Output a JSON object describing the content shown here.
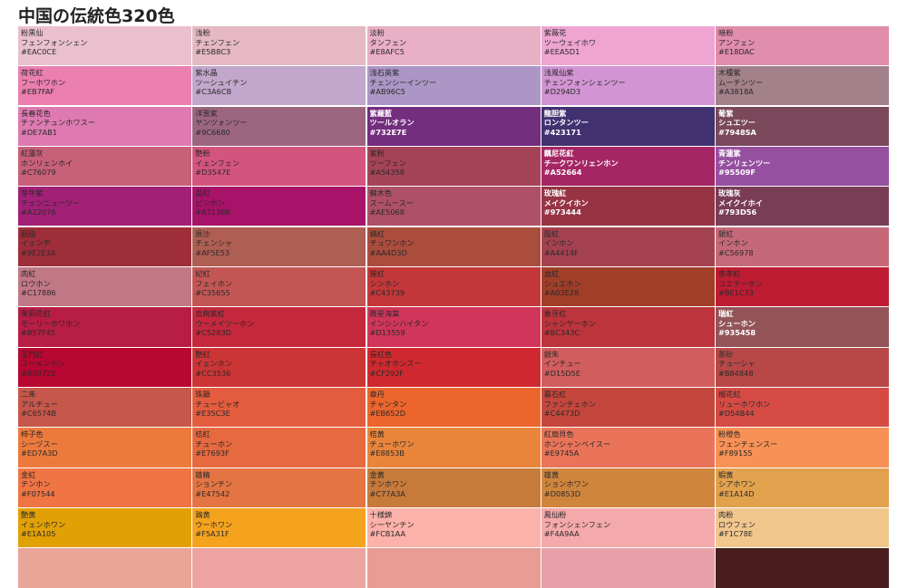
{
  "page": {
    "title": "中国の伝統色320色"
  },
  "colors": [
    {
      "name": "粉黒仙",
      "reading": "フェンフォンシェン",
      "hex": "#EAC0CE",
      "tone": "light"
    },
    {
      "name": "浅粉",
      "reading": "チェンフェン",
      "hex": "#E5B8C3",
      "tone": "light"
    },
    {
      "name": "淡粉",
      "reading": "タンフェン",
      "hex": "#E8AFC5",
      "tone": "light"
    },
    {
      "name": "紫薇花",
      "reading": "ツーウェイホワ",
      "hex": "#EEA5D1",
      "tone": "light"
    },
    {
      "name": "暗粉",
      "reading": "アンフェン",
      "hex": "#E18DAC",
      "tone": "light"
    },
    {
      "name": "荷花紅",
      "reading": "フーホワホン",
      "hex": "#EB7FAF",
      "tone": "light"
    },
    {
      "name": "紫水晶",
      "reading": "ツーシュイチン",
      "hex": "#C3A6CB",
      "tone": "light"
    },
    {
      "name": "浅石英紫",
      "reading": "チェンシーインツー",
      "hex": "#AB96C5",
      "tone": "light"
    },
    {
      "name": "浅風仙紫",
      "reading": "チェンフォンシェンツー",
      "hex": "#D294D3",
      "tone": "light"
    },
    {
      "name": "木槿紫",
      "reading": "ムーチンツー",
      "hex": "#A3818A",
      "tone": "light"
    },
    {
      "name": "長春花色",
      "reading": "チァンチュンホワスー",
      "hex": "#DE7AB1",
      "tone": "light"
    },
    {
      "name": "洋葱紫",
      "reading": "ヤンツォンツー",
      "hex": "#9C6680",
      "tone": "light"
    },
    {
      "name": "紫羅藍",
      "reading": "ツールオラン",
      "hex": "#732E7E",
      "tone": "dark"
    },
    {
      "name": "龍胆紫",
      "reading": "ロンタンツー",
      "hex": "#423171",
      "tone": "dark"
    },
    {
      "name": "葡紫",
      "reading": "シュエツー",
      "hex": "#7948SA",
      "tone": "dark"
    },
    {
      "name": "紅蓮灰",
      "reading": "ホンリェンホイ",
      "hex": "#C76079",
      "tone": "light"
    },
    {
      "name": "艶粉",
      "reading": "イェンフェン",
      "hex": "#D3547E",
      "tone": "light"
    },
    {
      "name": "紫粉",
      "reading": "ツーフェン",
      "hex": "#A54358",
      "tone": "light"
    },
    {
      "name": "藕尼花紅",
      "reading": "チークワンリェンホン",
      "hex": "#A52664",
      "tone": "dark"
    },
    {
      "name": "青蓮紫",
      "reading": "チンリェンツー",
      "hex": "#95509F",
      "tone": "dark"
    },
    {
      "name": "芽牛紫",
      "reading": "チェンニューツー",
      "hex": "#A22076",
      "tone": "light"
    },
    {
      "name": "品紅",
      "reading": "ピンホン",
      "hex": "#A71368",
      "tone": "light"
    },
    {
      "name": "蘇木色",
      "reading": "スームースー",
      "hex": "#AE5068",
      "tone": "light"
    },
    {
      "name": "玫瑰紅",
      "reading": "メイクイホン",
      "hex": "#973444",
      "tone": "dark"
    },
    {
      "name": "玫瑰灰",
      "reading": "メイクイホイ",
      "hex": "#793D56",
      "tone": "dark"
    },
    {
      "name": "胭脂",
      "reading": "イェンヂ",
      "hex": "#9E2E3A",
      "tone": "light"
    },
    {
      "name": "辰沙",
      "reading": "チェンシャ",
      "hex": "#AF5E53",
      "tone": "light"
    },
    {
      "name": "鶏紅",
      "reading": "チュワンホン",
      "hex": "#AA4D3D",
      "tone": "light"
    },
    {
      "name": "殷紅",
      "reading": "インホン",
      "hex": "#A4414F",
      "tone": "light"
    },
    {
      "name": "銀紅",
      "reading": "インホン",
      "hex": "#C56978",
      "tone": "light"
    },
    {
      "name": "肉紅",
      "reading": "ロウホン",
      "hex": "#C17886",
      "tone": "light"
    },
    {
      "name": "妃紅",
      "reading": "フェイホン",
      "hex": "#C35655",
      "tone": "light"
    },
    {
      "name": "猩紅",
      "reading": "シンホン",
      "hex": "#C43739",
      "tone": "light"
    },
    {
      "name": "血紅",
      "reading": "シュエホン",
      "hex": "#A03E28",
      "tone": "light"
    },
    {
      "name": "赤孝紅",
      "reading": "ユエテーホン",
      "hex": "#BE1C33",
      "tone": "light"
    },
    {
      "name": "茉莉花紅",
      "reading": "モーリーホワホン",
      "hex": "#B57F45",
      "tone": "light"
    },
    {
      "name": "烏梅紫紅",
      "reading": "ウーメイツーホン",
      "hex": "#C5283D",
      "tone": "light"
    },
    {
      "name": "霞星海棠",
      "reading": "インシンハイタン",
      "hex": "#D13559",
      "tone": "light"
    },
    {
      "name": "象牙紅",
      "reading": "シャンヤーホン",
      "hex": "#BC343C",
      "tone": "light"
    },
    {
      "name": "瑞紅",
      "reading": "シューホン",
      "hex": "#935458",
      "tone": "dark"
    },
    {
      "name": "玉門紅",
      "reading": "ユーメンホン",
      "hex": "#B80722",
      "tone": "light"
    },
    {
      "name": "艶紅",
      "reading": "イェンホン",
      "hex": "#CC3536",
      "tone": "light"
    },
    {
      "name": "長紅色",
      "reading": "チャオホンスー",
      "hex": "#CF292F",
      "tone": "light"
    },
    {
      "name": "銀朱",
      "reading": "インチュー",
      "hex": "#D15D5E",
      "tone": "light"
    },
    {
      "name": "茶砂",
      "reading": "チューシャ",
      "hex": "#B84848",
      "tone": "light"
    },
    {
      "name": "二朱",
      "reading": "アルチュー",
      "hex": "#C6574B",
      "tone": "light"
    },
    {
      "name": "珠顕",
      "reading": "チュービャオ",
      "hex": "#E35C3E",
      "tone": "light"
    },
    {
      "name": "章丹",
      "reading": "チャンタン",
      "hex": "#EB652D",
      "tone": "light"
    },
    {
      "name": "暮石紅",
      "reading": "ファンチェホン",
      "hex": "#C4473D",
      "tone": "light"
    },
    {
      "name": "榴花紅",
      "reading": "リューホワホン",
      "hex": "#D54B44",
      "tone": "light"
    },
    {
      "name": "柿子色",
      "reading": "シーヅスー",
      "hex": "#ED7A3D",
      "tone": "light"
    },
    {
      "name": "桔紅",
      "reading": "チューホン",
      "hex": "#E7693F",
      "tone": "light"
    },
    {
      "name": "桔黄",
      "reading": "チューホワン",
      "hex": "#E8853B",
      "tone": "light"
    },
    {
      "name": "紅扇貝色",
      "reading": "ホンシャンベイスー",
      "hex": "#E9745A",
      "tone": "light"
    },
    {
      "name": "粉橙色",
      "reading": "フェンチェンスー",
      "hex": "#F89155",
      "tone": "light"
    },
    {
      "name": "金紅",
      "reading": "チンホン",
      "hex": "#F07544",
      "tone": "light"
    },
    {
      "name": "雄精",
      "reading": "ションチン",
      "hex": "#E47542",
      "tone": "light"
    },
    {
      "name": "金黄",
      "reading": "チンホワン",
      "hex": "#C77A3A",
      "tone": "light"
    },
    {
      "name": "雄黄",
      "reading": "ションホワン",
      "hex": "#D0853D",
      "tone": "light"
    },
    {
      "name": "蝦黄",
      "reading": "シアホワン",
      "hex": "#E1A14D",
      "tone": "light"
    },
    {
      "name": "艶黄",
      "reading": "イェンホワン",
      "hex": "#E1A105",
      "tone": "light"
    },
    {
      "name": "鶏黄",
      "reading": "ウーホワン",
      "hex": "#F5A31F",
      "tone": "light"
    },
    {
      "name": "十様錦",
      "reading": "シーヤンチン",
      "hex": "#FCB1AA",
      "tone": "light"
    },
    {
      "name": "鳳仙粉",
      "reading": "フォンシェンフェン",
      "hex": "#F4A9AA",
      "tone": "light"
    },
    {
      "name": "肉粉",
      "reading": "ロウフェン",
      "hex": "#F1C78E",
      "tone": "light"
    }
  ],
  "bottom_strip": [
    "#E9A598",
    "#EDA3A0",
    "#E89C93",
    "#E8A1A8",
    "#4A1E1E"
  ]
}
